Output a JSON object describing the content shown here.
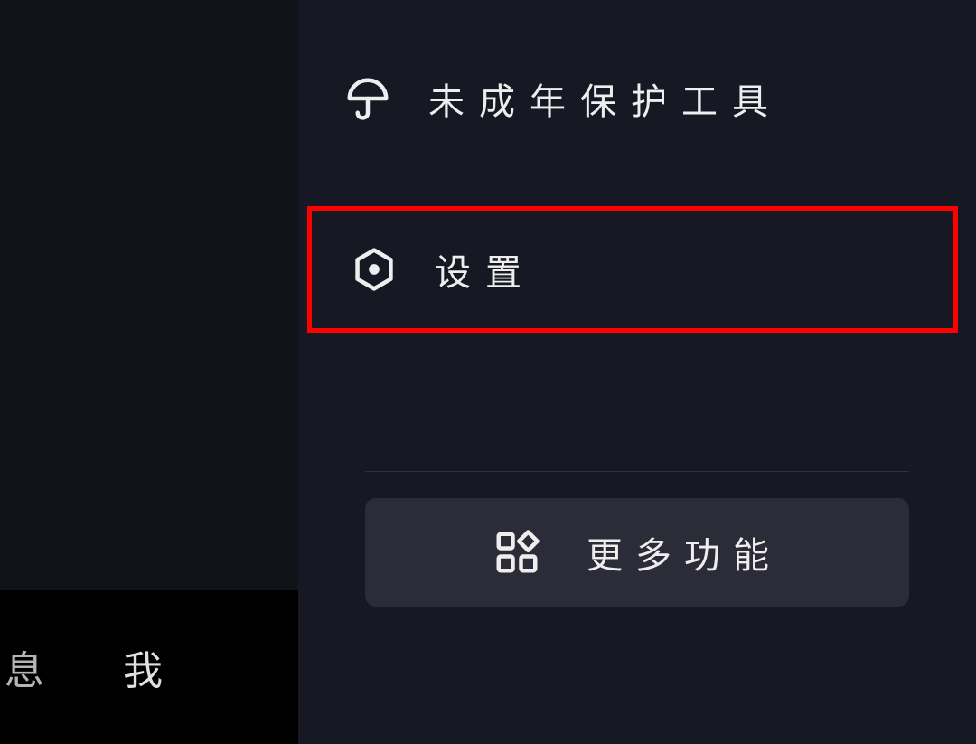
{
  "menu": {
    "minor_protection": {
      "label": "未成年保护工具",
      "icon": "umbrella-icon"
    },
    "settings": {
      "label": "设置",
      "icon": "settings-hex-icon"
    }
  },
  "more_button": {
    "label": "更多功能",
    "icon": "apps-icon"
  },
  "bottom_nav": {
    "item1": "息",
    "item2": "我"
  },
  "highlight": {
    "target": "settings",
    "color": "#ff0000"
  }
}
